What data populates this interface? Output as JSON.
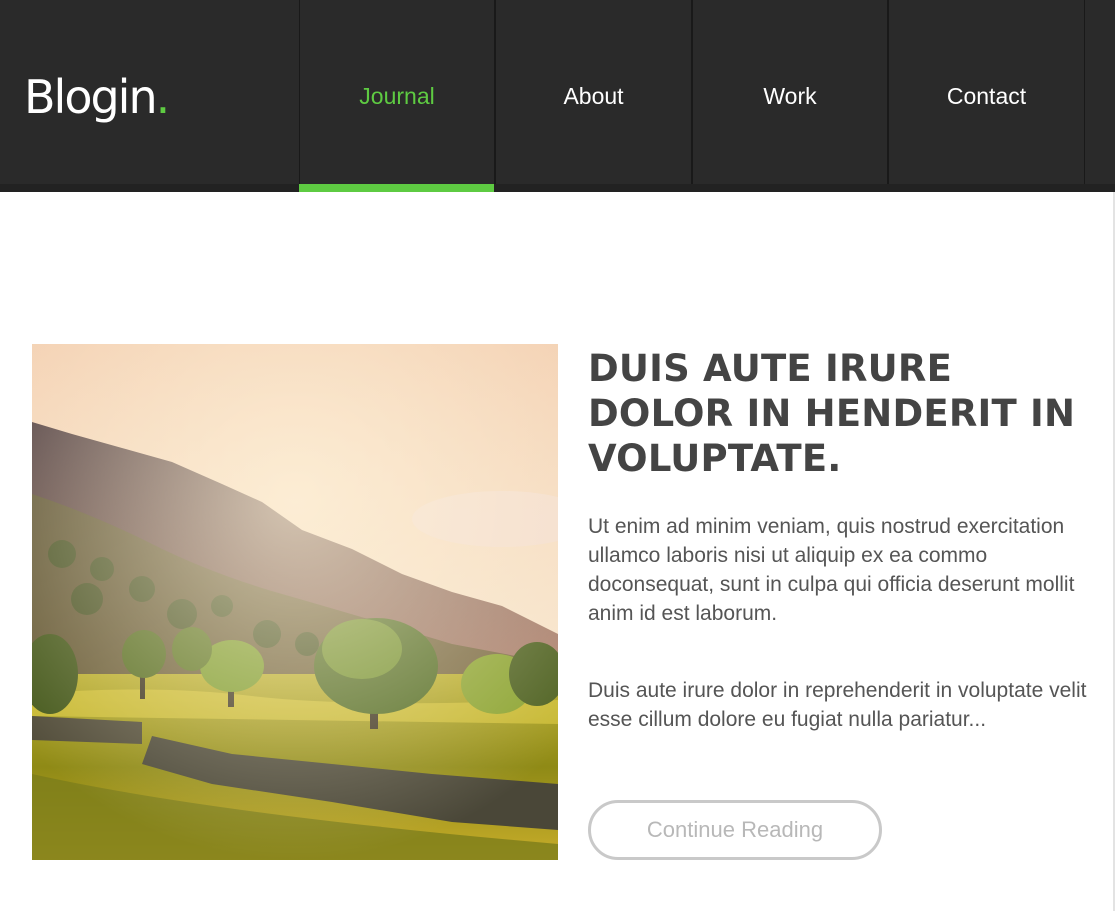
{
  "header": {
    "logo_text": "Blogin",
    "logo_dot": ".",
    "nav": [
      {
        "label": "Journal",
        "active": true
      },
      {
        "label": "About",
        "active": false
      },
      {
        "label": "Work",
        "active": false
      },
      {
        "label": "Contact",
        "active": false
      }
    ]
  },
  "post": {
    "title": "DUIS AUTE IRURE DOLOR IN HENDERIT IN VOLUPTATE.",
    "excerpt": [
      "Ut enim ad minim veniam, quis nostrud exercitation ullamco laboris nisi ut aliquip ex ea commo doconsequat, sunt in culpa qui officia deserunt mollit anim id est laborum.",
      "Duis aute irure dolor in reprehenderit in voluptate velit esse cillum dolore eu fugiat nulla pariatur..."
    ],
    "button_label": "Continue Reading",
    "image": "countryside-landscape-photo"
  },
  "colors": {
    "accent": "#5ecb42",
    "header_bg": "#2a2a2a",
    "title": "#444444",
    "body_text": "#555555",
    "button_border": "#c9c9c9"
  }
}
